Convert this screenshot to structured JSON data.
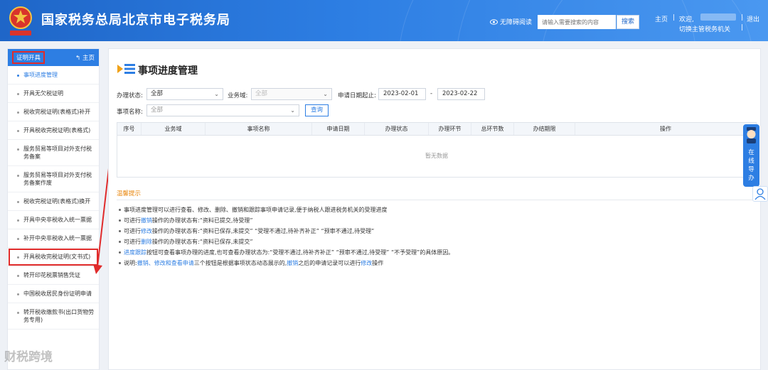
{
  "header": {
    "site_title": "国家税务总局北京市电子税务局",
    "accessibility": "无障碍阅读",
    "search_placeholder": "请输入需要搜索的内容",
    "search_button": "搜索",
    "home": "主页",
    "separator": "|",
    "welcome": "欢迎,",
    "switch_org": "切换主管税务机关",
    "logout": "退出"
  },
  "sidebar": {
    "active_menu": "证明开具",
    "home": "主页",
    "items": [
      {
        "label": "事项进度管理",
        "current": true
      },
      {
        "label": "开具无欠税证明"
      },
      {
        "label": "税收完税证明(表格式)补开"
      },
      {
        "label": "开具税收完税证明(表格式)"
      },
      {
        "label": "服务贸易等项目对外支付税务备案"
      },
      {
        "label": "服务贸易等项目对外支付税务备案作废"
      },
      {
        "label": "税收完税证明(表格式)换开"
      },
      {
        "label": "开具中央非税收入统一票据"
      },
      {
        "label": "补开中央非税收入统一票据"
      },
      {
        "label": "开具税收完税证明(文书式)",
        "highlighted": true
      },
      {
        "label": "转开印花税票销售凭证"
      },
      {
        "label": "中国税收居民身份证明申请"
      },
      {
        "label": "转开税收缴款书(出口货物劳务专用)"
      }
    ]
  },
  "main": {
    "page_title": "事项进度管理",
    "filters": {
      "status_label": "办理状态:",
      "status_value": "全部",
      "domain_label": "业务域:",
      "domain_value": "全部",
      "date_label": "申请日期起止:",
      "date_from": "2023-02-01",
      "date_sep": "-",
      "date_to": "2023-02-22",
      "name_label": "事项名称:",
      "name_value": "全部",
      "query_button": "查询"
    },
    "table": {
      "columns": [
        "序号",
        "业务域",
        "事项名称",
        "申请日期",
        "办理状态",
        "办理环节",
        "总环节数",
        "办结期限",
        "操作"
      ],
      "empty_text": "暂无数据"
    },
    "tips": {
      "title": "温馨提示",
      "line1": "事项进度管理可以进行查看、修改、删除、撤销和跟踪事项申请记录,便于纳税人跟进税务机关的受理进度",
      "line2_a": "可进行",
      "line2_b": "撤销",
      "line2_c": "操作的办理状态有:“资料已提交,待受理”",
      "line3_a": "可进行",
      "line3_b": "修改",
      "line3_c": "操作的办理状态有:“资料已保存,未提交” “受理不通过,待补齐补正” “预审不通过,待受理”",
      "line4_a": "可进行",
      "line4_b": "删除",
      "line4_c": "操作的办理状态有:“资料已保存,未提交”",
      "line5_a": "进度跟踪",
      "line5_b": "按钮可查看事项办理的进度,也可查看办理状态为:“受理不通过,待补齐补正” “预审不通过,待受理” “不予受理”的具体原因。",
      "line6_a": "说明:",
      "line6_b": "撤销、修改和查看申请",
      "line6_c": "三个按钮是根据事项状态动态展示的,",
      "line6_d": "撤销",
      "line6_e": "之后的申请记录可以进行",
      "line6_f": "修改",
      "line6_g": "操作"
    }
  },
  "float": {
    "help_text": "在线导办"
  },
  "watermark": "财税跨境",
  "colors": {
    "primary": "#2d7ee3",
    "header": "#1f66c8",
    "annotation": "#e02b2b",
    "tip_title": "#e8860c"
  }
}
